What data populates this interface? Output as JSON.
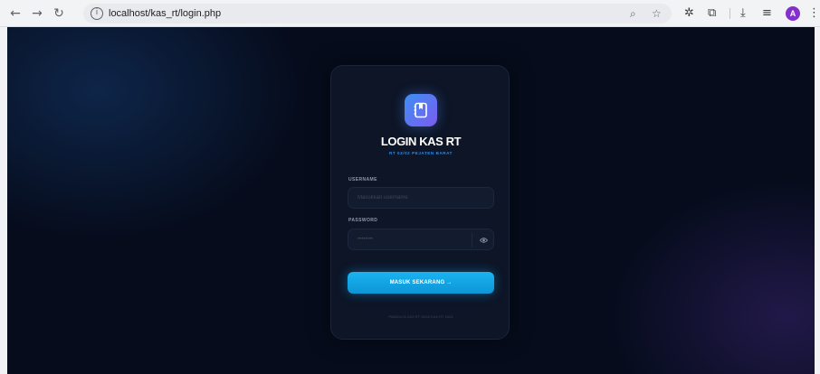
{
  "browser": {
    "url": "localhost/kas_rt/login.php",
    "profile_initial": "A",
    "nav_icons": [
      "back-arrow-icon",
      "forward-arrow-icon",
      "reload-icon"
    ],
    "toolbar_icons": [
      "zoom-icon",
      "bookmark-star-icon",
      "extensions-icon",
      "screen-capture-icon",
      "download-icon",
      "tab-search-icon",
      "menu-icon"
    ]
  },
  "login": {
    "title": "LOGIN KAS RT",
    "subtitle": "RT 03/02 PEJATEN BARAT",
    "username_label": "USERNAME",
    "username_placeholder": "Masukkan username",
    "password_label": "PASSWORD",
    "password_placeholder": "••••••••",
    "submit_label": "MASUK SEKARANG →",
    "footer": "PANDUCA KAS RT 03/02 KAS RT 2024"
  },
  "colors": {
    "background": "#060c1c",
    "card": "#0d1526",
    "accent": "#1ab3f0",
    "logo_gradient": [
      "#3d8ff2",
      "#7b5cf0"
    ],
    "subtitle": "#2f8de4"
  }
}
